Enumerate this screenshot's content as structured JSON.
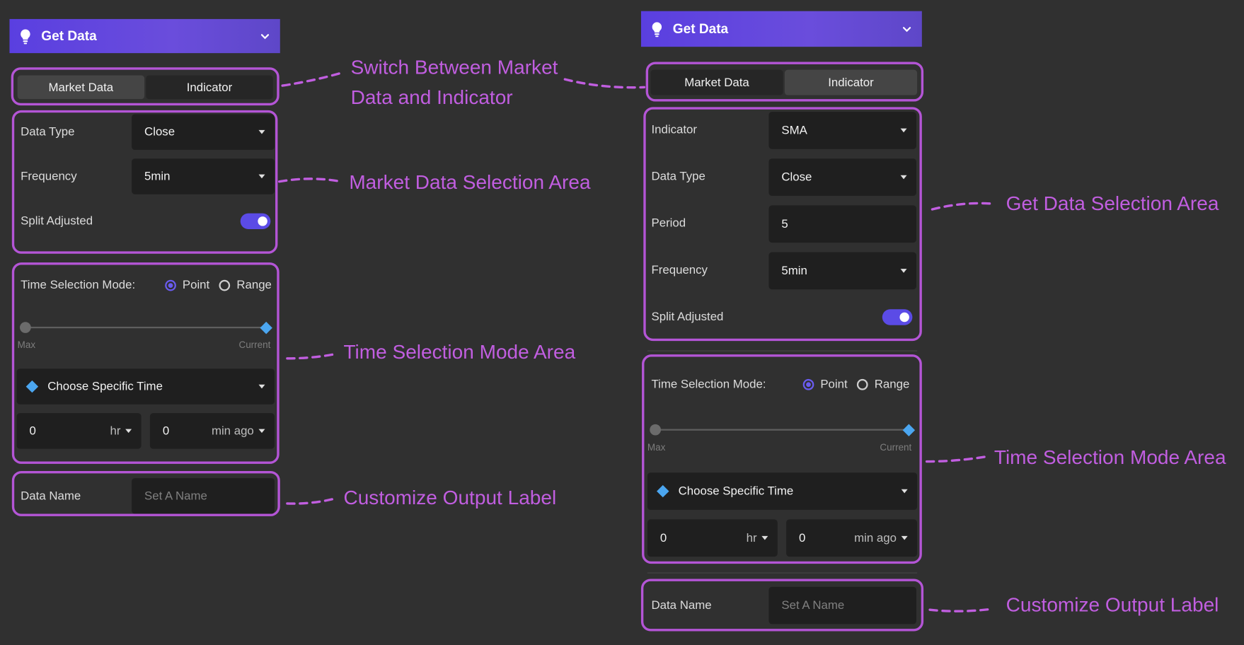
{
  "colors": {
    "accent": "#5b4be6",
    "highlight": "#b455d6",
    "annotation": "#c15ee0",
    "diamond": "#4ba6f0",
    "background": "#303030"
  },
  "left_panel": {
    "header": {
      "title": "Get Data",
      "icon": "lightbulb-icon",
      "chevron": "chevron-down-icon"
    },
    "tabs": [
      {
        "label": "Market Data",
        "active": true
      },
      {
        "label": "Indicator",
        "active": false
      }
    ],
    "fields": {
      "data_type": {
        "label": "Data Type",
        "value": "Close"
      },
      "frequency": {
        "label": "Frequency",
        "value": "5min"
      },
      "split_adjusted": {
        "label": "Split Adjusted",
        "on": true
      }
    },
    "time": {
      "mode_label": "Time Selection Mode:",
      "options": [
        {
          "label": "Point",
          "selected": true
        },
        {
          "label": "Range",
          "selected": false
        }
      ],
      "slider_min_label": "Max",
      "slider_max_label": "Current",
      "choose_label": "Choose Specific Time",
      "hours_value": "0",
      "hours_unit": "hr",
      "minutes_value": "0",
      "minutes_unit": "min ago"
    },
    "data_name": {
      "label": "Data Name",
      "placeholder": "Set A Name"
    }
  },
  "right_panel": {
    "header": {
      "title": "Get Data",
      "icon": "lightbulb-icon",
      "chevron": "chevron-down-icon"
    },
    "tabs": [
      {
        "label": "Market Data",
        "active": false
      },
      {
        "label": "Indicator",
        "active": true
      }
    ],
    "fields": {
      "indicator": {
        "label": "Indicator",
        "value": "SMA"
      },
      "data_type": {
        "label": "Data Type",
        "value": "Close"
      },
      "period": {
        "label": "Period",
        "value": "5"
      },
      "frequency": {
        "label": "Frequency",
        "value": "5min"
      },
      "split_adjusted": {
        "label": "Split Adjusted",
        "on": true
      }
    },
    "time": {
      "mode_label": "Time Selection Mode:",
      "options": [
        {
          "label": "Point",
          "selected": true
        },
        {
          "label": "Range",
          "selected": false
        }
      ],
      "slider_min_label": "Max",
      "slider_max_label": "Current",
      "choose_label": "Choose Specific Time",
      "hours_value": "0",
      "hours_unit": "hr",
      "minutes_value": "0",
      "minutes_unit": "min ago"
    },
    "data_name": {
      "label": "Data Name",
      "placeholder": "Set A Name"
    }
  },
  "annotations": {
    "switch_line1": "Switch Between Market",
    "switch_line2": "Data and Indicator",
    "market_area": "Market Data Selection Area",
    "time_left": "Time Selection Mode Area",
    "output_left": "Customize Output Label",
    "get_area": "Get Data Selection Area",
    "time_right": "Time Selection Mode Area",
    "output_right": "Customize Output Label"
  }
}
